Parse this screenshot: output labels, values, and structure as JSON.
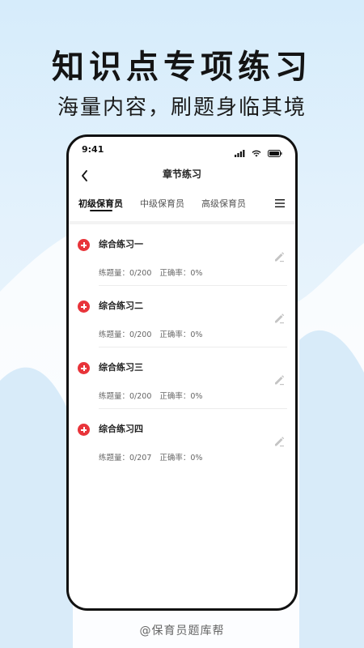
{
  "promo": {
    "headline": "知识点专项练习",
    "subline": "海量内容，刷题身临其境"
  },
  "status_bar": {
    "time": "9:41"
  },
  "nav": {
    "title": "章节练习"
  },
  "tabs": [
    {
      "label": "初级保育员",
      "active": true
    },
    {
      "label": "中级保育员",
      "active": false
    },
    {
      "label": "高级保育员",
      "active": false
    }
  ],
  "items": [
    {
      "title": "综合练习一",
      "count": "练题量：0/200",
      "accuracy": "正确率：0%"
    },
    {
      "title": "综合练习二",
      "count": "练题量：0/200",
      "accuracy": "正确率：0%"
    },
    {
      "title": "综合练习三",
      "count": "练题量：0/200",
      "accuracy": "正确率：0%"
    },
    {
      "title": "综合练习四",
      "count": "练题量：0/207",
      "accuracy": "正确率：0%"
    }
  ],
  "footer": {
    "text": "@保育员题库帮"
  },
  "colors": {
    "accent_red": "#e8343a",
    "bg_blue": "#d6ecfb",
    "text_dark": "#141414"
  },
  "icons": {
    "back": "chevron-left-icon",
    "menu": "hamburger-menu-icon",
    "plus": "plus-circle-icon",
    "edit": "pencil-icon",
    "signal": "signal-icon",
    "wifi": "wifi-icon",
    "battery": "battery-icon"
  }
}
